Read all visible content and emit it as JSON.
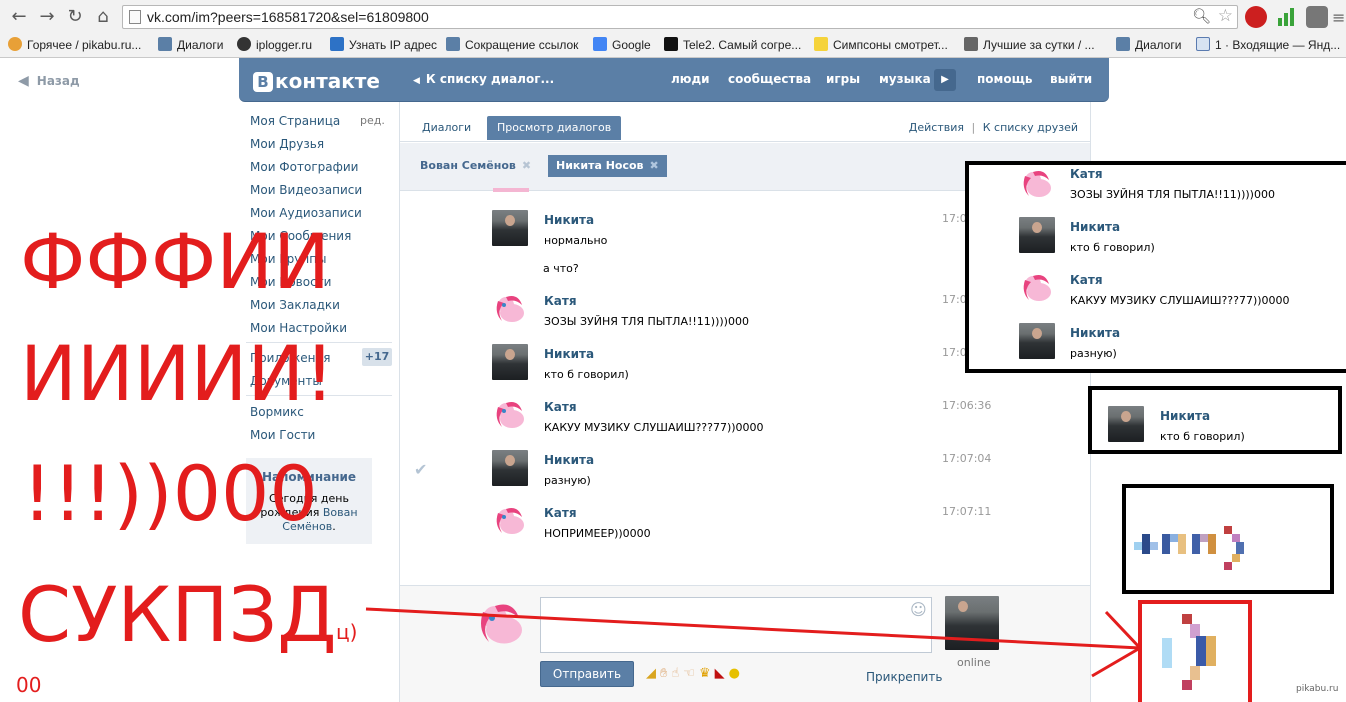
{
  "browser": {
    "url": "vk.com/im?peers=168581720&sel=61809800",
    "bookmarks": [
      "Горячее / pikabu.ru...",
      "Диалоги",
      "iplogger.ru",
      "Узнать IP адрес",
      "Сокращение ссылок",
      "Google",
      "Tele2. Самый согре...",
      "Симпсоны смотрет...",
      "Лучшие за сутки / ...",
      "Диалоги",
      "1 · Входящие — Янд..."
    ]
  },
  "back_label": "Назад",
  "vk": {
    "logo_text": "контакте",
    "logo_letter": "В",
    "breadcrumb": "К списку диалог...",
    "nav": [
      "люди",
      "сообщества",
      "игры",
      "музыка",
      "помощь",
      "выйти"
    ]
  },
  "menu": {
    "items": [
      "Моя Страница",
      "Мои Друзья",
      "Мои Фотографии",
      "Мои Видеозаписи",
      "Мои Аудиозаписи",
      "Мои Сообщения",
      "Мои Группы",
      "Мои Новости",
      "Мои Закладки",
      "Мои Настройки",
      "Приложения",
      "Документы",
      "Вормикс",
      "Мои Гости"
    ],
    "edit_label": "ред.",
    "apps_badge": "+17",
    "reminder": {
      "title": "Напоминание",
      "line1": "Сегодня день",
      "line2_prefix": "рождения ",
      "line2_link": "Вован",
      "line3_link": "Семёнов",
      "line3_suffix": "."
    }
  },
  "tabs": {
    "dialogs": "Диалоги",
    "view": "Просмотр диалогов",
    "actions": "Действия",
    "separator": "|",
    "to_friends": "К списку друзей"
  },
  "peers": [
    "Вован Семёнов",
    "Никита Носов"
  ],
  "messages": [
    {
      "author": "Никита",
      "lines": [
        "нормально",
        "а что?"
      ],
      "time": "17:0"
    },
    {
      "author": "Катя",
      "lines": [
        "ЗОЗЫ ЗУЙНЯ ТЛЯ ПЫТЛА!!11))))000"
      ],
      "time": "17:0"
    },
    {
      "author": "Никита",
      "lines": [
        "кто б говорил)"
      ],
      "time": "17:0"
    },
    {
      "author": "Катя",
      "lines": [
        "КАКУУ МУЗИКУ СЛУШАИШ???77))0000"
      ],
      "time": "17:06:36"
    },
    {
      "author": "Никита",
      "lines": [
        "разную)"
      ],
      "time": "17:07:04"
    },
    {
      "author": "Катя",
      "lines": [
        "НОПРИМЕЕР))0000"
      ],
      "time": "17:07:11"
    }
  ],
  "composer": {
    "send_label": "Отправить",
    "attach_label": "Прикрепить",
    "online_label": "online"
  },
  "overlay": {
    "zoom_box": [
      {
        "author": "Катя",
        "text": "ЗОЗЫ ЗУЙНЯ ТЛЯ ПЫТЛА!!11))))000"
      },
      {
        "author": "Никита",
        "text": "кто б говорил)"
      },
      {
        "author": "Катя",
        "text": "КАКУУ МУЗИКУ СЛУШАИШ???77))0000"
      },
      {
        "author": "Никита",
        "text": "разную)"
      }
    ],
    "focus_box": {
      "author": "Никита",
      "text": "кто б говорил)"
    },
    "big_text": [
      "ФФФИИ",
      "ИИИИИ!",
      "!!!))000",
      "СУКПЗД"
    ],
    "small_suffix": "ц)",
    "tiny_text": "00",
    "watermark": "pikabu.ru"
  },
  "colors": {
    "vk_blue": "#5b7fa6",
    "vk_link": "#2b587a",
    "annotation_red": "#e31d1d"
  }
}
